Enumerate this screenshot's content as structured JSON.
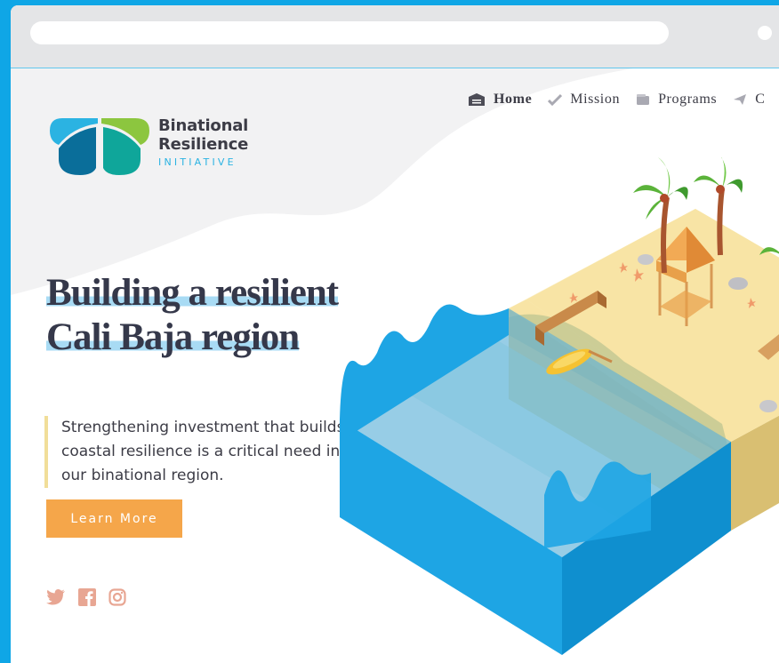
{
  "brand": {
    "name_line1": "Binational",
    "name_line2": "Resilience",
    "name_line3": "INITIATIVE",
    "colors": {
      "blue": "#2bb3e2",
      "green": "#8cc63f",
      "teal": "#0fa69a",
      "navy": "#0a6e9a"
    }
  },
  "nav": {
    "items": [
      {
        "label": "Home",
        "icon": "house-icon",
        "active": true
      },
      {
        "label": "Mission",
        "icon": "checkmark-icon",
        "active": false
      },
      {
        "label": "Programs",
        "icon": "wallet-icon",
        "active": false
      },
      {
        "label": "C",
        "icon": "paper-plane-icon",
        "active": false
      }
    ]
  },
  "hero": {
    "title_line1": "Building a resilient",
    "title_line2": "Cali Baja region",
    "lead": "Strengthening investment that builds coastal resilience is a critical need in our binational region.",
    "cta_label": "Learn More"
  },
  "social": [
    "twitter-icon",
    "facebook-icon",
    "instagram-icon"
  ],
  "colors": {
    "frame": "#0fa6e6",
    "chrome": "#e4e5e7",
    "heading": "#35384a",
    "highlight": "#a8dbf4",
    "accent": "#f5a64a",
    "social": "#e8a693"
  }
}
